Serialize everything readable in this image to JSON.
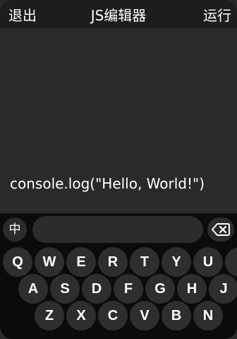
{
  "header": {
    "exit_label": "退出",
    "title": "JS编辑器",
    "run_label": "运行"
  },
  "editor": {
    "code": "console.log(\"Hello, World!\")"
  },
  "keyboard": {
    "lang_label": "中",
    "input_value": "",
    "row1": [
      "Q",
      "W",
      "E",
      "R",
      "T",
      "Y",
      "U",
      "I"
    ],
    "row2": [
      "A",
      "S",
      "D",
      "F",
      "G",
      "H",
      "J"
    ],
    "row3": [
      "Z",
      "X",
      "C",
      "V",
      "B",
      "N"
    ]
  }
}
